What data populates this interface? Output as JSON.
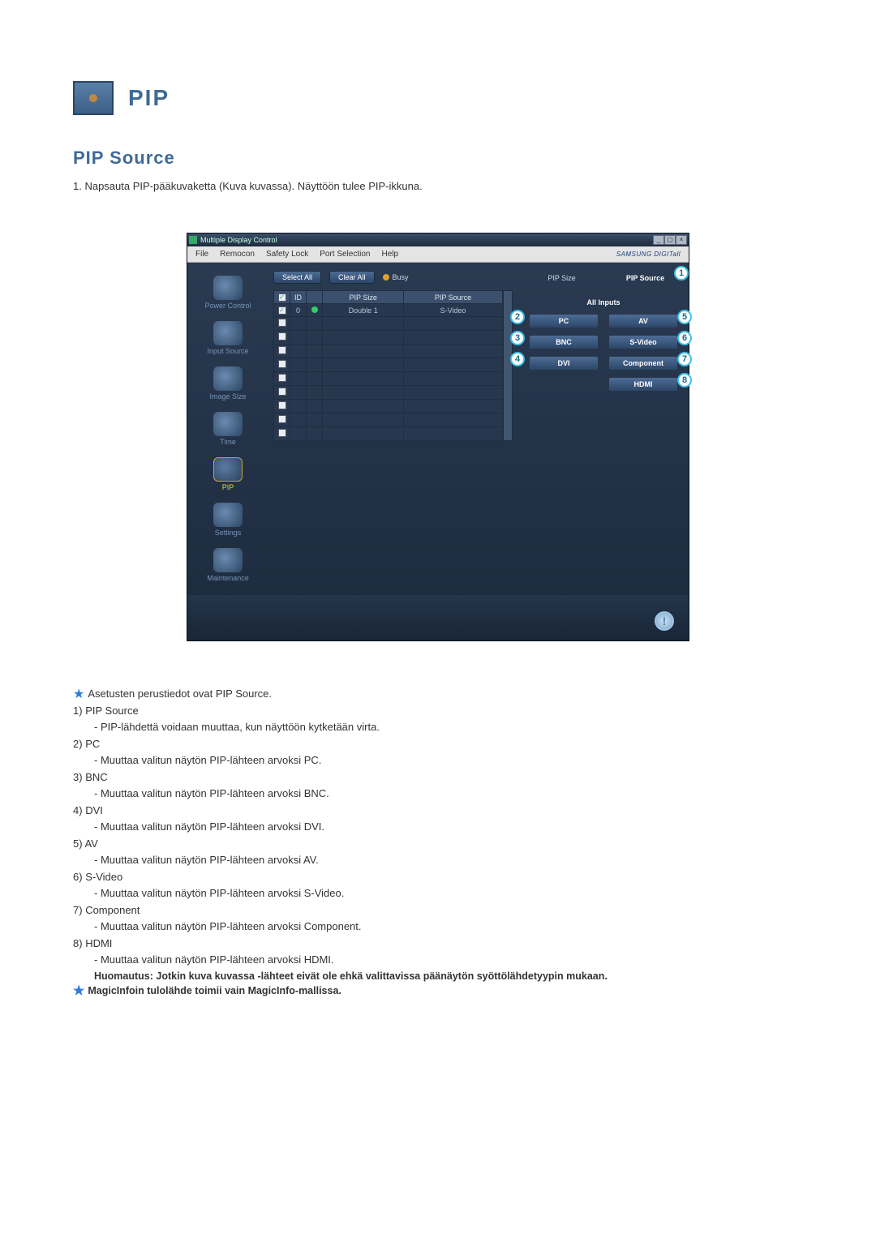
{
  "header": {
    "title": "PIP"
  },
  "section": {
    "title": "PIP Source",
    "instruction": "1. Napsauta PIP-pääkuvaketta (Kuva kuvassa). Näyttöön tulee PIP-ikkuna."
  },
  "window": {
    "title": "Multiple Display Control",
    "brand": "SAMSUNG DIGITall",
    "menu": [
      "File",
      "Remocon",
      "Safety Lock",
      "Port Selection",
      "Help"
    ],
    "toolbar": {
      "select_all": "Select All",
      "clear_all": "Clear All",
      "busy": "Busy"
    },
    "sidebar": [
      {
        "key": "power",
        "label": "Power Control"
      },
      {
        "key": "input",
        "label": "Input Source"
      },
      {
        "key": "image",
        "label": "Image Size"
      },
      {
        "key": "time",
        "label": "Time"
      },
      {
        "key": "pip",
        "label": "PIP"
      },
      {
        "key": "settings",
        "label": "Settings"
      },
      {
        "key": "maint",
        "label": "Maintenance"
      }
    ],
    "grid": {
      "headers": {
        "chk": "✓",
        "id": "ID",
        "status": "⬤",
        "size": "PIP Size",
        "source": "PIP Source"
      },
      "row": {
        "id": "0",
        "size": "Double 1",
        "source": "S-Video"
      }
    },
    "right": {
      "tabs": {
        "size": "PIP Size",
        "source": "PIP Source"
      },
      "section": "All Inputs",
      "buttons": {
        "pc": "PC",
        "av": "AV",
        "bnc": "BNC",
        "svideo": "S-Video",
        "dvi": "DVI",
        "component": "Component",
        "hdmi": "HDMI"
      }
    },
    "badges": {
      "b1": "1",
      "b2": "2",
      "b3": "3",
      "b4": "4",
      "b5": "5",
      "b6": "6",
      "b7": "7",
      "b8": "8"
    }
  },
  "desc": {
    "intro": "Asetusten perustiedot ovat PIP Source.",
    "items": [
      {
        "n": "1)",
        "t": "PIP Source",
        "d": "- PIP-lähdettä voidaan muuttaa, kun näyttöön kytketään virta."
      },
      {
        "n": "2)",
        "t": "PC",
        "d": "- Muuttaa valitun näytön PIP-lähteen arvoksi PC."
      },
      {
        "n": "3)",
        "t": "BNC",
        "d": "- Muuttaa valitun näytön PIP-lähteen arvoksi BNC."
      },
      {
        "n": "4)",
        "t": "DVI",
        "d": "- Muuttaa valitun näytön PIP-lähteen arvoksi DVI."
      },
      {
        "n": "5)",
        "t": "AV",
        "d": "- Muuttaa valitun näytön PIP-lähteen arvoksi AV."
      },
      {
        "n": "6)",
        "t": "S-Video",
        "d": "- Muuttaa valitun näytön PIP-lähteen arvoksi S-Video."
      },
      {
        "n": "7)",
        "t": "Component",
        "d": "- Muuttaa valitun näytön PIP-lähteen arvoksi Component."
      },
      {
        "n": "8)",
        "t": "HDMI",
        "d": "- Muuttaa valitun näytön PIP-lähteen arvoksi HDMI."
      }
    ],
    "note": "Huomautus: Jotkin kuva kuvassa -lähteet eivät ole ehkä valittavissa päänäytön syöttölähdetyypin mukaan.",
    "magic": "MagicInfoin tulolähde toimii vain MagicInfo-mallissa."
  }
}
